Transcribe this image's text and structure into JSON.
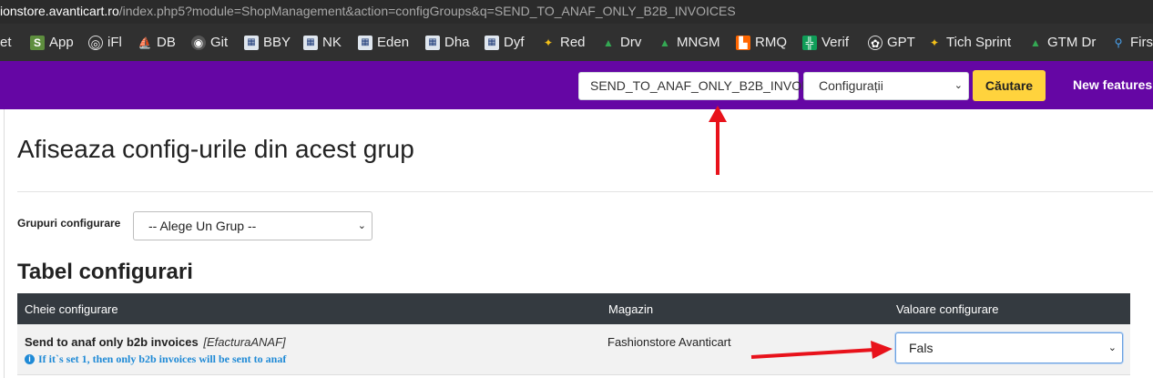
{
  "browser": {
    "url_host": "ionstore.avanticart.ro",
    "url_path": "/index.php5?module=ShopManagement&action=configGroups&q=SEND_TO_ANAF_ONLY_B2B_INVOICES"
  },
  "bookmarks": [
    {
      "label": "et",
      "icon": "folder-icon"
    },
    {
      "label": "App",
      "icon": "shopify-icon"
    },
    {
      "label": "iFl",
      "icon": "iflow-icon"
    },
    {
      "label": "DB",
      "icon": "db-icon"
    },
    {
      "label": "Git",
      "icon": "github-icon"
    },
    {
      "label": "BBY",
      "icon": "monitor-icon"
    },
    {
      "label": "NK",
      "icon": "monitor-icon"
    },
    {
      "label": "Eden",
      "icon": "monitor-icon"
    },
    {
      "label": "Dha",
      "icon": "monitor-icon"
    },
    {
      "label": "Dyf",
      "icon": "monitor-icon"
    },
    {
      "label": "Red",
      "icon": "octopus-icon"
    },
    {
      "label": "Drv",
      "icon": "drive-icon"
    },
    {
      "label": "MNGM",
      "icon": "drive-icon"
    },
    {
      "label": "RMQ",
      "icon": "rabbitmq-icon"
    },
    {
      "label": "Verif",
      "icon": "sheets-icon"
    },
    {
      "label": "GPT",
      "icon": "openai-icon"
    },
    {
      "label": "Tich Sprint",
      "icon": "octopus-icon"
    },
    {
      "label": "GTM Dr",
      "icon": "drive-icon"
    },
    {
      "label": "Firs",
      "icon": "pin-icon"
    }
  ],
  "topnav": {
    "search_value": "SEND_TO_ANAF_ONLY_B2B_INVOIC",
    "search_type": "Configurații",
    "search_button": "Căutare",
    "new_features": "New features"
  },
  "page": {
    "title": "Afiseaza config-urile din acest grup",
    "group_label": "Grupuri configurare",
    "group_select": "-- Alege Un Grup --",
    "table_title": "Tabel configurari"
  },
  "table": {
    "headers": [
      "Cheie configurare",
      "Magazin",
      "Valoare configurare"
    ],
    "rows": [
      {
        "key": "Send to anaf only b2b invoices",
        "code": "[EfacturaANAF]",
        "hint": "If it`s set 1, then only b2b invoices will be sent to anaf",
        "shop": "Fashionstore Avanticart",
        "value": "Fals"
      }
    ]
  },
  "colors": {
    "nav_purple": "#6506a4",
    "search_button": "#ffd33d",
    "table_header": "#343a40",
    "hint_blue": "#1f8ad6",
    "annotation_red": "#e8121b"
  }
}
